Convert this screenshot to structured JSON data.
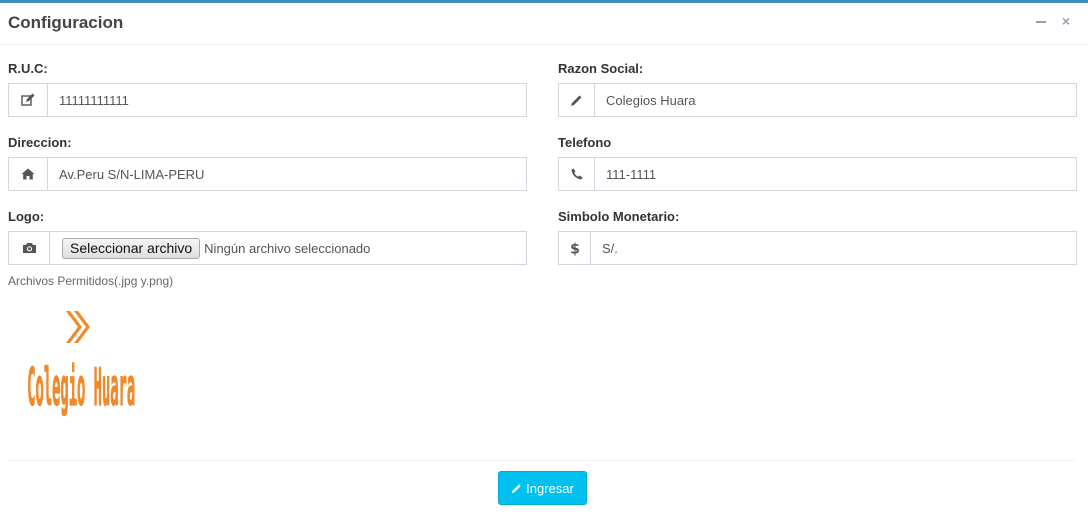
{
  "panel": {
    "title": "Configuracion",
    "tools": {
      "minimize_icon": "minus-icon",
      "close_label": "×"
    }
  },
  "fields": {
    "ruc": {
      "label": "R.U.C:",
      "value": "11111111111",
      "icon": "edit-icon"
    },
    "razon_social": {
      "label": "Razon Social:",
      "value": "Colegios Huara",
      "icon": "pencil-icon"
    },
    "direccion": {
      "label": "Direccion:",
      "value": "Av.Peru S/N-LIMA-PERU",
      "icon": "home-icon"
    },
    "telefono": {
      "label": "Telefono",
      "value": "111-1111",
      "icon": "phone-icon"
    },
    "logo": {
      "label": "Logo:",
      "button_label": "Seleccionar archivo",
      "status": "Ningún archivo seleccionado",
      "icon": "camera-icon"
    },
    "simbolo": {
      "label": "Simbolo Monetario:",
      "value": "S/.",
      "icon": "dollar-icon"
    }
  },
  "hint": "Archivos Permitidos(.jpg y.png)",
  "logo_image": {
    "text": "Colegio Huara",
    "color": "#f0892a"
  },
  "submit": {
    "label": "Ingresar",
    "color": "#00c0ef"
  }
}
